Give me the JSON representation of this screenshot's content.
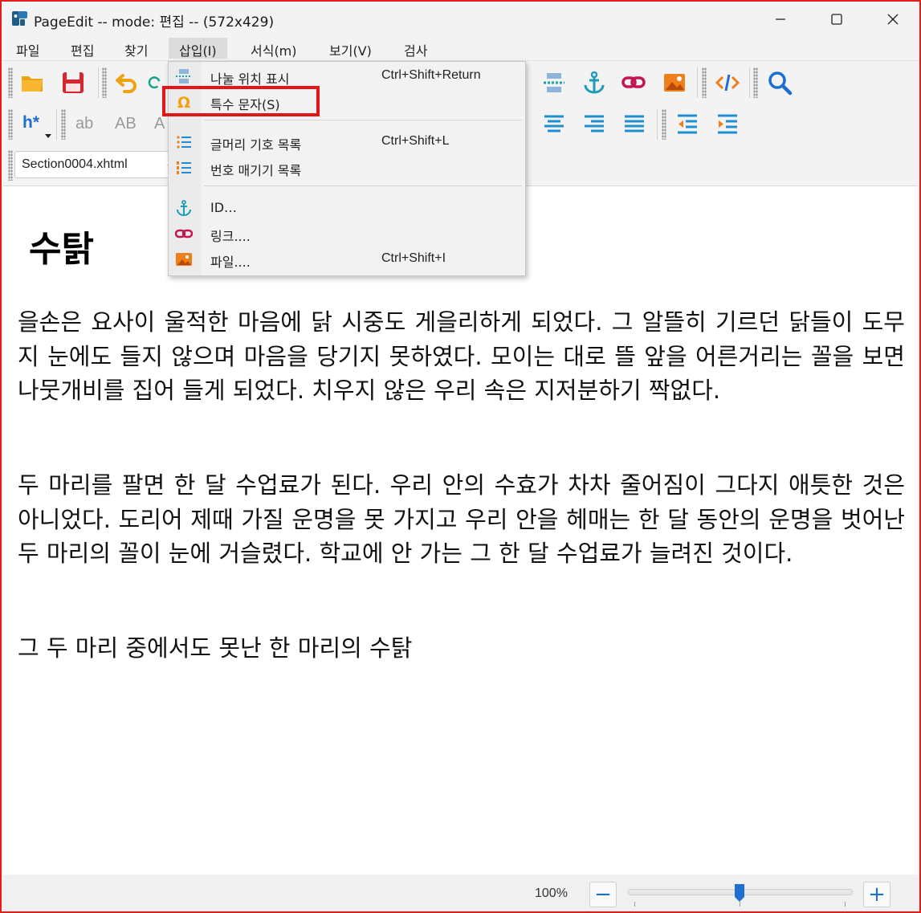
{
  "window": {
    "title": "PageEdit -- mode: 편집 -- (572x429)",
    "border_color": "#e21b1b"
  },
  "menubar": {
    "items": [
      "파일",
      "편집",
      "찾기",
      "삽입(I)",
      "서식(m)",
      "보기(V)",
      "검사"
    ],
    "active": "삽입(I)"
  },
  "toolbar": {
    "icons": [
      "folder-open-icon",
      "save-icon",
      "undo-icon",
      "redo-icon",
      "split-marker-icon",
      "anchor-icon",
      "link-icon",
      "image-icon",
      "code-view-icon",
      "search-icon"
    ],
    "heading_button": "h*",
    "text_buttons": [
      "ab",
      "AB",
      "A"
    ],
    "align_icons": [
      "align-center-icon",
      "align-right-icon",
      "align-justify-icon",
      "outdent-icon",
      "indent-icon"
    ],
    "file_select": "Section0004.xhtml"
  },
  "insert_menu": {
    "items": [
      {
        "icon": "split-marker-icon",
        "label": "나눌 위치 표시",
        "shortcut": "Ctrl+Shift+Return"
      },
      {
        "icon": "omega-icon",
        "label": "특수 문자(S)",
        "shortcut": ""
      },
      {
        "icon": "bullet-list-icon",
        "label": "글머리 기호 목록",
        "shortcut": "Ctrl+Shift+L"
      },
      {
        "icon": "numbered-list-icon",
        "label": "번호 매기기 목록",
        "shortcut": ""
      },
      {
        "icon": "anchor-icon",
        "label": "ID…",
        "shortcut": ""
      },
      {
        "icon": "link-icon",
        "label": "링크....",
        "shortcut": ""
      },
      {
        "icon": "image-icon",
        "label": "파일....",
        "shortcut": "Ctrl+Shift+I"
      }
    ],
    "highlighted": "특수 문자(S)"
  },
  "document": {
    "heading": "수탉",
    "paragraphs": [
      "을손은 요사이 울적한 마음에 닭 시중도 게을리하게 되었다. 그 알뜰히 기르던 닭들이 도무지 눈에도 들지 않으며 마음을 당기지 못하였다. 모이는 대로 뜰 앞을 어른거리는 꼴을 보면 나뭇개비를 집어 들게 되었다. 치우지 않은 우리 속은 지저분하기 짝없다.",
      "두 마리를 팔면 한 달 수업료가 된다. 우리 안의 수효가 차차 줄어짐이 그다지 애틋한 것은 아니었다. 도리어 제때 가질 운명을 못 가지고 우리 안을 헤매는 한 달 동안의 운명을 벗어난 두 마리의 꼴이 눈에 거슬렸다. 학교에 안 가는 그 한 달 수업료가 늘려진 것이다.",
      "그 두 마리 중에서도 못난 한 마리의 수탉"
    ]
  },
  "statusbar": {
    "zoom": "100%",
    "zoom_out": "−",
    "zoom_in": "+",
    "zoom_slider_value": 0.5
  }
}
